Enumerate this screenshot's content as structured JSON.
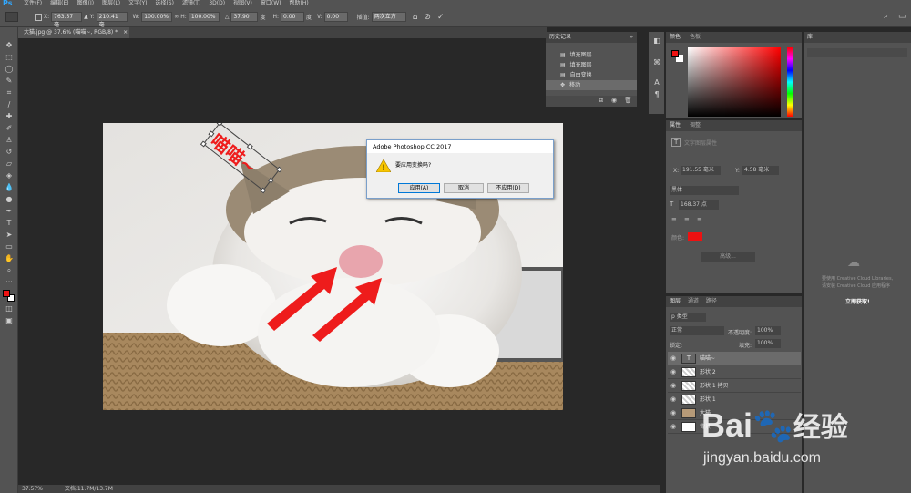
{
  "app": {
    "logo": "Ps",
    "menus": [
      "文件(F)",
      "编辑(E)",
      "图像(I)",
      "图层(L)",
      "文字(Y)",
      "选择(S)",
      "滤镜(T)",
      "3D(D)",
      "视图(V)",
      "窗口(W)",
      "帮助(H)"
    ]
  },
  "options": {
    "x_label": "X:",
    "x_value": "763.57 毫",
    "y_label": "Y:",
    "y_value": "210.41 毫",
    "w_label": "W:",
    "w_value": "100.00%",
    "h_label": "H:",
    "h_value": "100.00%",
    "angle_label": "△",
    "angle_value": "37.90",
    "deg1": "度",
    "hs_label": "H:",
    "hs_value": "0.00",
    "deg2": "度",
    "vs_label": "V:",
    "vs_value": "0.00",
    "interp_label": "插值:",
    "interp_value": "两次立方"
  },
  "document": {
    "tab_title": "大猫.jpg @ 37.6% (喵喵~, RGB/8) *",
    "zoom": "37.57%",
    "doc_size": "文档:11.7M/13.7M"
  },
  "canvas": {
    "overlay_text": "喵喵~"
  },
  "dialog": {
    "title": "Adobe Photoshop CC 2017",
    "message": "要应用变换吗?",
    "apply": "应用(A)",
    "cancel": "取消",
    "dont_apply": "不应用(D)"
  },
  "history": {
    "header": "历史记录",
    "items": [
      "填充图层",
      "填充图层",
      "自由变换",
      "移动"
    ]
  },
  "color": {
    "tab1": "颜色",
    "tab2": "色板",
    "foreground": "#ee1111",
    "background": "#ffffff"
  },
  "properties": {
    "tab1": "属性",
    "tab2": "调整",
    "subtitle": "文字图层属性",
    "x_label": "X:",
    "x_value": "191.55 毫米",
    "y_label": "Y:",
    "y_value": "4.58 毫米",
    "font": "黑体",
    "font_size": "168.37 点",
    "color_label": "颜色:",
    "text_color": "#ee1111",
    "button": "高级..."
  },
  "library": {
    "header": "库",
    "info_line1": "要使用 Creative Cloud Libraries,",
    "info_line2": "请安装 Creative Cloud 应用程序",
    "button": "立即获取!"
  },
  "layers": {
    "tab1": "图层",
    "tab2": "通道",
    "tab3": "路径",
    "filter_label": "p 类型",
    "blend": "正常",
    "opacity_label": "不透明度:",
    "opacity": "100%",
    "lock_label": "锁定:",
    "fill_label": "填充:",
    "fill": "100%",
    "items": [
      {
        "name": "喵喵~",
        "kind": "text"
      },
      {
        "name": "形状 2",
        "kind": "shape"
      },
      {
        "name": "形状 1 拷贝",
        "kind": "shape"
      },
      {
        "name": "形状 1",
        "kind": "shape"
      },
      {
        "name": "大猫",
        "kind": "image"
      },
      {
        "name": "背景",
        "kind": "white"
      }
    ]
  },
  "watermark": {
    "brand": "Bai",
    "brand2": "经验",
    "url": "jingyan.baidu.com"
  }
}
